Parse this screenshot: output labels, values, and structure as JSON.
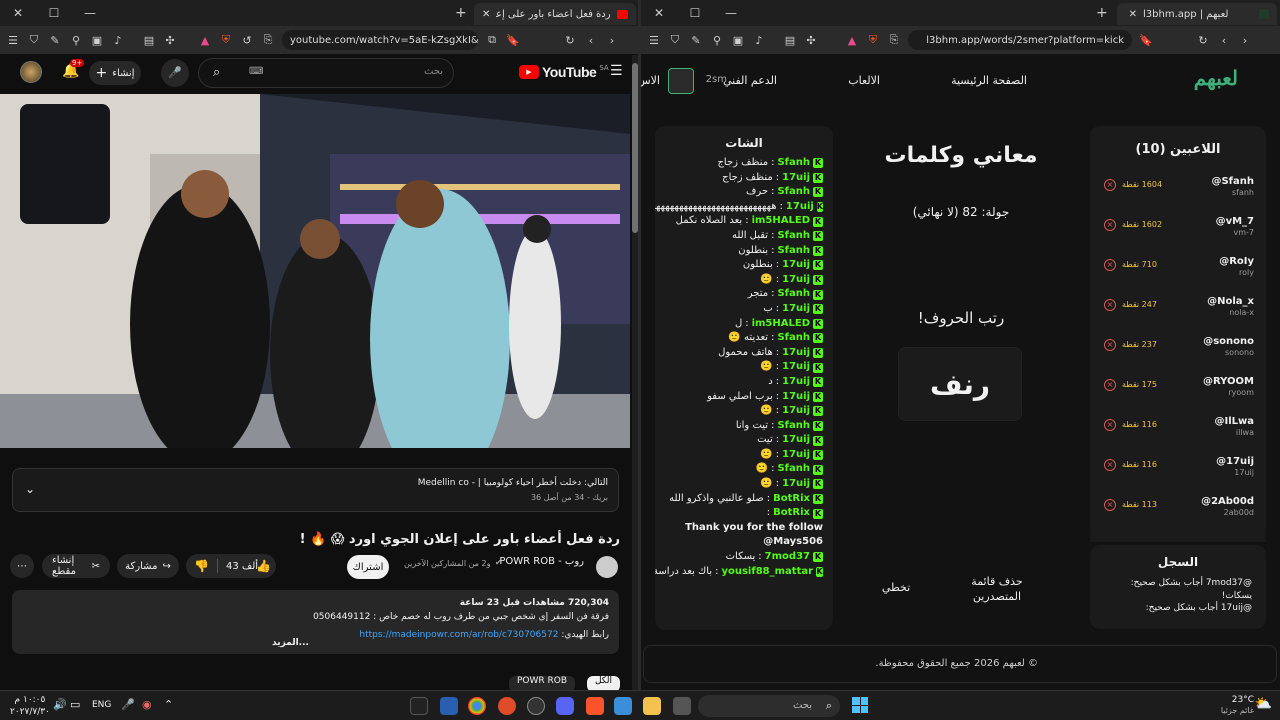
{
  "left": {
    "tab_title": "ردة فعل أعضاء باور على إعلان ال",
    "url": "youtube.com/watch?v=5aE-kZsgXkI&list=...",
    "yt": {
      "logo": "YouTube",
      "region": "SA",
      "search_placeholder": "بحث",
      "create_label": "إنشاء",
      "notif_count": "9+",
      "playlist_title": "التالي: دخلت أخطر احياء كولومبيا | - Medellin co",
      "playlist_sub": "بريك - 34 من أصل 36",
      "video_title": "ردة فعل أعضاء باور على إعلان الجوي اورد 😱 🔥 !",
      "channel_name": "روب - POWR ROB",
      "channel_sub": "و2 من المشاركين الآخرين",
      "subscribe": "اشتراك",
      "likes": "43 ألف",
      "share": "مشاركة",
      "clip": "إنشاء مقطع",
      "desc_views": "720,304 مشاهدات قبل 23 ساعة",
      "desc_line": "فرقة فن السفر إي شخص جبي من طرف روب له خصم خاص : 0506449112",
      "desc_link": "https://madeinpowr.com/ar/rob/c730706572",
      "desc_link_label": "رابط الهيدي:",
      "more": "...المزيد",
      "chip1": "الكل",
      "chip2": "POWR ROB"
    }
  },
  "right": {
    "tab_title": "l3bhm.app | لعبهم",
    "url": "l3bhm.app/words/2smer?platform=kick",
    "logo": "لعبهم",
    "nav": [
      "الصفحة الرئيسية",
      "الالعاب",
      "الدعم الفني"
    ],
    "nav_cut": "الاس",
    "user": "2sm",
    "players_title": "اللاعبين (10)",
    "players": [
      {
        "name": "@Sfanh",
        "handle": "sfanh",
        "points": "1604 نقطة"
      },
      {
        "name": "@vM_7",
        "handle": "vm-7",
        "points": "1602 نقطة"
      },
      {
        "name": "@RoIy",
        "handle": "roly",
        "points": "710 نقطة"
      },
      {
        "name": "@Nola_x",
        "handle": "nola-x",
        "points": "247 نقطة"
      },
      {
        "name": "@sonono",
        "handle": "sonono",
        "points": "237 نقطة"
      },
      {
        "name": "@RYOOM",
        "handle": "ryoom",
        "points": "175 نقطة"
      },
      {
        "name": "@IlLwa",
        "handle": "illwa",
        "points": "116 نقطة"
      },
      {
        "name": "@17uij",
        "handle": "17uij",
        "points": "116 نقطة"
      },
      {
        "name": "@2Ab00d",
        "handle": "2ab00d",
        "points": "113 نقطة"
      }
    ],
    "log_title": "السجل",
    "log": [
      "@7mod37 أجاب بشكل صحيح: يسكات!",
      "@17uij أجاب بشكل صحيح:"
    ],
    "game_title": "معاني وكلمات",
    "round": "جولة: 82 (لا نهائي)",
    "prompt": "رتب الحروف!",
    "word": "رنف",
    "btn_remove": "حذف قائمة المتصدرين",
    "btn_skip": "تخطي",
    "chat_title": "الشات",
    "chat": [
      {
        "u": "Sfanh",
        "m": "منظف زجاج"
      },
      {
        "u": "17uij",
        "m": "منظف زجاج"
      },
      {
        "u": "Sfanh",
        "m": "حرف"
      },
      {
        "u": "17uij",
        "m": "ههههههههههههههههههههههههههههه"
      },
      {
        "u": "im5HALED",
        "m": "بعد الصلاه نكمل"
      },
      {
        "u": "Sfanh",
        "m": "تقبل الله"
      },
      {
        "u": "Sfanh",
        "m": "بنطلون"
      },
      {
        "u": "17uij",
        "m": "بنطلون"
      },
      {
        "u": "17uij",
        "m": "🙂"
      },
      {
        "u": "Sfanh",
        "m": "متجر"
      },
      {
        "u": "17uij",
        "m": "ب"
      },
      {
        "u": "im5HALED",
        "m": "ل"
      },
      {
        "u": "Sfanh",
        "m": "تعديته 🙂"
      },
      {
        "u": "17uij",
        "m": "هاتف محمول"
      },
      {
        "u": "17uij",
        "m": "🙂"
      },
      {
        "u": "17uij",
        "m": "د"
      },
      {
        "u": "17uij",
        "m": "برب اصلي سفو"
      },
      {
        "u": "17uij",
        "m": "🙂"
      },
      {
        "u": "Sfanh",
        "m": "تيت وانا"
      },
      {
        "u": "17uij",
        "m": "تيت"
      },
      {
        "u": "17uij",
        "m": "🙂"
      },
      {
        "u": "Sfanh",
        "m": "🙂"
      },
      {
        "u": "17uij",
        "m": "🙂"
      },
      {
        "u": "BotRix",
        "m": "صلو عالنبي واذكرو الله"
      },
      {
        "u": "BotRix",
        "m": ""
      },
      {
        "u": "",
        "m": "Thank you for the follow @Mays506"
      },
      {
        "u": "7mod37",
        "m": "يسكات"
      },
      {
        "u": "yousif88_mattar",
        "m": "باك بعد دراسة"
      }
    ],
    "footer": "© لعبهم 2026 جميع الحقوق محفوظة."
  },
  "taskbar": {
    "weather_temp": "23°C",
    "weather_desc": "غائم جزئيا",
    "search": "بحث",
    "lang": "ENG",
    "time": "١٠:٠٥ م",
    "date": "٢٠٢٧/٧/٣٠"
  }
}
